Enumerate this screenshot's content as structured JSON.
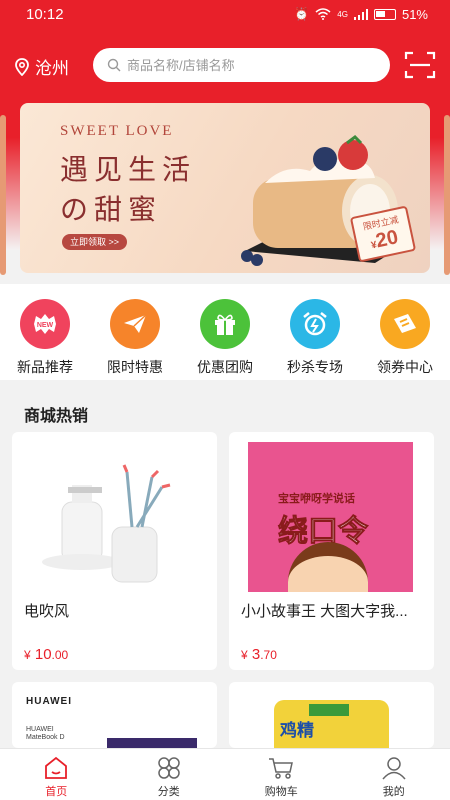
{
  "status_bar": {
    "time": "10:12",
    "battery": "51%",
    "network": "4G"
  },
  "header": {
    "city": "沧州",
    "search_placeholder": "商品名称/店铺名称"
  },
  "banner": {
    "kicker": "SWEET LOVE",
    "line1": "遇见生活",
    "line2": "の甜蜜",
    "button": "立即领取 >>",
    "tag_top": "限时立减",
    "tag_currency": "¥",
    "tag_amount": "20"
  },
  "categories": [
    {
      "label": "新品推荐",
      "icon": "new-icon",
      "color": "#f0435d"
    },
    {
      "label": "限时特惠",
      "icon": "paper-plane-icon",
      "color": "#f6842a"
    },
    {
      "label": "优惠团购",
      "icon": "gift-icon",
      "color": "#4cc23a"
    },
    {
      "label": "秒杀专场",
      "icon": "alarm-clock-icon",
      "color": "#2bb7e6"
    },
    {
      "label": "领券中心",
      "icon": "ticket-icon",
      "color": "#f9a821"
    }
  ],
  "section": {
    "title": "商城热销"
  },
  "products": [
    {
      "name": "电吹风",
      "currency": "¥",
      "price_int": "10",
      "price_dec": ".00"
    },
    {
      "name": "小小故事王 大图大字我...",
      "currency": "¥",
      "price_int": "3",
      "price_dec": ".70",
      "cover_title": "宝宝咿呀学说话",
      "cover_big": "绕口令"
    },
    {
      "brand": "HUAWEI",
      "model": "HUAWEI MateBook D"
    },
    {
      "cover_text": "鸡精"
    }
  ],
  "tabs": [
    {
      "label": "首页",
      "icon": "home-icon",
      "active": true
    },
    {
      "label": "分类",
      "icon": "category-icon",
      "active": false
    },
    {
      "label": "购物车",
      "icon": "cart-icon",
      "active": false
    },
    {
      "label": "我的",
      "icon": "user-icon",
      "active": false
    }
  ],
  "colors": {
    "accent": "#e8202a",
    "price": "#e8202a"
  }
}
